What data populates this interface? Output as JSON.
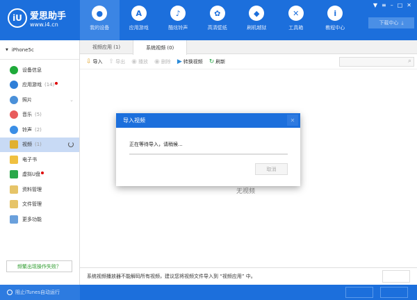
{
  "app": {
    "logo_mark": "iU",
    "name": "爱思助手",
    "url": "www.i4.cn"
  },
  "nav": [
    {
      "label": "我的设备",
      "icon": "apple-icon",
      "glyph": "●"
    },
    {
      "label": "应用游戏",
      "icon": "app-store-icon",
      "glyph": "A"
    },
    {
      "label": "酷炫铃声",
      "icon": "bell-icon",
      "glyph": "♪"
    },
    {
      "label": "高清壁纸",
      "icon": "flower-icon",
      "glyph": "✿"
    },
    {
      "label": "刷机越狱",
      "icon": "dropbox-icon",
      "glyph": "◆"
    },
    {
      "label": "工具箱",
      "icon": "tools-icon",
      "glyph": "✕"
    },
    {
      "label": "教程中心",
      "icon": "info-icon",
      "glyph": "i"
    }
  ],
  "download_center": "下载中心",
  "device": "iPhone5c",
  "sidebar": [
    {
      "label": "设备信息",
      "icon": "device-info-icon",
      "color": "#1faa3a"
    },
    {
      "label": "应用游戏",
      "count": "(14)",
      "badge": true,
      "icon": "apps-icon",
      "color": "#2f7fd8"
    },
    {
      "label": "照片",
      "icon": "photo-icon",
      "color": "#4a90d9",
      "chevron": true
    },
    {
      "label": "音乐",
      "count": "(5)",
      "icon": "music-icon",
      "color": "#e85c5c"
    },
    {
      "label": "铃声",
      "count": "(2)",
      "icon": "ringtone-icon",
      "color": "#3a8ee6"
    },
    {
      "label": "视频",
      "count": "(1)",
      "icon": "video-icon",
      "color": "#e0b030",
      "active": true
    },
    {
      "label": "电子书",
      "icon": "book-icon",
      "color": "#f0c040"
    },
    {
      "label": "虚拟U盘",
      "badge": true,
      "icon": "usb-icon",
      "color": "#2aa84a"
    },
    {
      "label": "资料管理",
      "icon": "data-icon",
      "color": "#e6c468"
    },
    {
      "label": "文件管理",
      "icon": "file-icon",
      "color": "#e6c468"
    },
    {
      "label": "更多功能",
      "icon": "more-icon",
      "color": "#6aa0dc"
    }
  ],
  "fail_button": "频繁出现操作失败？",
  "tabs": [
    {
      "label": "视频应用 (1)"
    },
    {
      "label": "系统视频 (0)",
      "active": true
    }
  ],
  "toolbar": [
    {
      "label": "导入",
      "icon": "import-icon",
      "glyph": "⇩",
      "enabled": true
    },
    {
      "label": "导出",
      "icon": "export-icon",
      "glyph": "⇧",
      "enabled": false
    },
    {
      "label": "播放",
      "icon": "play-icon",
      "glyph": "◉",
      "enabled": false
    },
    {
      "label": "删除",
      "icon": "delete-icon",
      "glyph": "◉",
      "enabled": false
    },
    {
      "label": "转换视频",
      "icon": "convert-icon",
      "glyph": "▶",
      "enabled": true
    },
    {
      "label": "刷新",
      "icon": "refresh-icon",
      "glyph": "↻",
      "enabled": true
    }
  ],
  "empty_text": "无视频",
  "info_text": "系统视频播放器不能解码所有视频，建议您将视频文件导入到 “视频应用” 中。",
  "footer_label": "阻止iTunes自动运行",
  "dialog": {
    "title": "导入视频",
    "message": "正在等待导入，请稍候...",
    "progress": 0,
    "cancel": "取消"
  }
}
